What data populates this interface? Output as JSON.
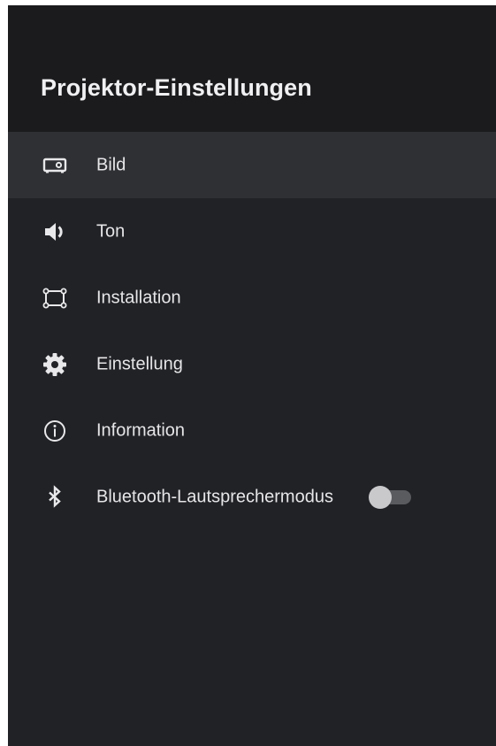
{
  "header": {
    "title": "Projektor-Einstellungen"
  },
  "menu": {
    "items": [
      {
        "label": "Bild",
        "icon": "projector-icon",
        "selected": true
      },
      {
        "label": "Ton",
        "icon": "speaker-icon",
        "selected": false
      },
      {
        "label": "Installation",
        "icon": "installation-frame-icon",
        "selected": false
      },
      {
        "label": "Einstellung",
        "icon": "gear-icon",
        "selected": false
      },
      {
        "label": "Information",
        "icon": "info-icon",
        "selected": false
      },
      {
        "label": "Bluetooth-Lautsprechermodus",
        "icon": "bluetooth-icon",
        "selected": false,
        "toggle": "off"
      }
    ]
  },
  "colors": {
    "background": "#212226",
    "header_background": "#1b1b1d",
    "selected_row": "#2f3034",
    "text": "#e6e6e8"
  }
}
